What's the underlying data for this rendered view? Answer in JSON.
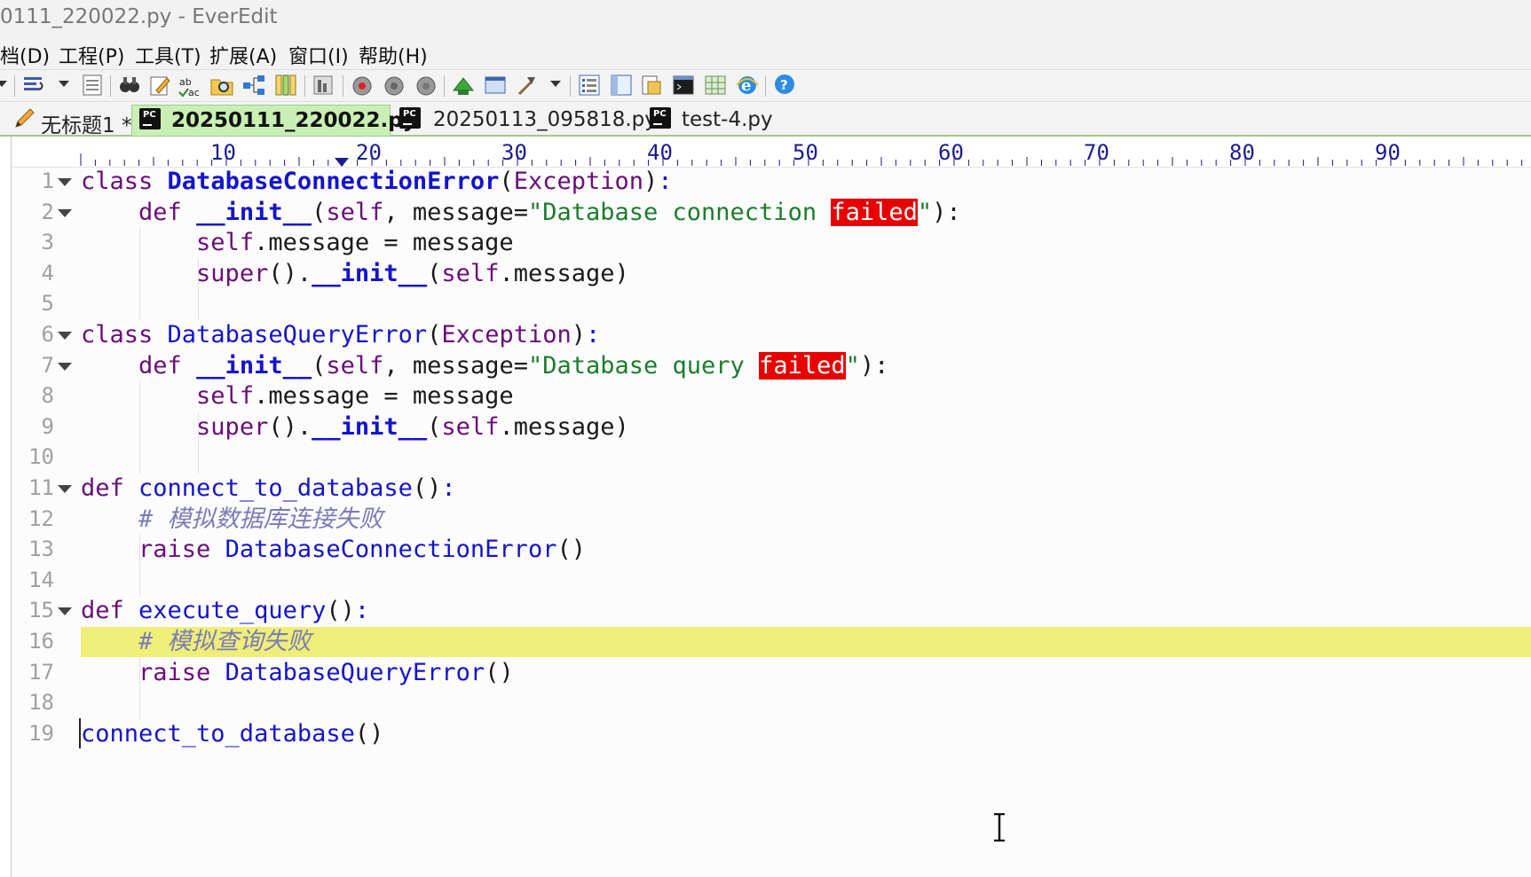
{
  "window": {
    "title": "0111_220022.py - EverEdit"
  },
  "menu": [
    "档(D)",
    "工程(P)",
    "工具(T)",
    "扩展(A)",
    "窗口(I)",
    "帮助(H)"
  ],
  "toolbar": {
    "buttons": [
      "word-wrap-icon",
      "document-icon",
      "find-icon",
      "edit-icon",
      "spell-check-icon",
      "find-in-files-icon",
      "split-icon",
      "columns-icon",
      "macro-icon",
      "record-macro-icon",
      "play-macro-icon",
      "stop-macro-icon",
      "plugin-icon",
      "window-icon",
      "tool-icon",
      "list-icon",
      "panel-icon",
      "clip-icon",
      "terminal-icon",
      "grid-icon",
      "browser-icon",
      "help-icon"
    ]
  },
  "tabs": [
    {
      "label": "无标题1 *",
      "active": false
    },
    {
      "label": "20250111_220022.py",
      "active": true
    },
    {
      "label": "20250113_095818.py",
      "active": false
    },
    {
      "label": "test-4.py",
      "active": false
    }
  ],
  "ruler": {
    "marks": [
      "10",
      "20",
      "30",
      "40",
      "50",
      "60",
      "70",
      "80",
      "90"
    ]
  },
  "editor": {
    "line_numbers": [
      "1",
      "2",
      "3",
      "4",
      "5",
      "6",
      "7",
      "8",
      "9",
      "10",
      "11",
      "12",
      "13",
      "14",
      "15",
      "16",
      "17",
      "18",
      "19"
    ],
    "current_line": "16",
    "lines": [
      [
        [
          "kw",
          "class "
        ],
        [
          "kb",
          "DatabaseConnectionError"
        ],
        [
          "",
          "("
        ],
        [
          "kw",
          "Exception"
        ],
        [
          "",
          ")"
        ],
        [
          "fn",
          ":"
        ]
      ],
      [
        [
          "",
          "    "
        ],
        [
          "kw",
          "def "
        ],
        [
          "kb",
          "__init__"
        ],
        [
          "",
          "("
        ],
        [
          "sf",
          "self"
        ],
        [
          "",
          ", message="
        ],
        [
          "str",
          "\"Database connection "
        ],
        [
          "red",
          "failed"
        ],
        [
          "str",
          "\""
        ],
        [
          "",
          "):"
        ]
      ],
      [
        [
          "",
          "        "
        ],
        [
          "sf",
          "self"
        ],
        [
          "",
          ".message = message"
        ]
      ],
      [
        [
          "",
          "        "
        ],
        [
          "sf",
          "super"
        ],
        [
          "",
          "()."
        ],
        [
          "kb",
          "__init__"
        ],
        [
          "",
          "("
        ],
        [
          "sf",
          "self"
        ],
        [
          "",
          ".message)"
        ]
      ],
      [
        [
          "",
          ""
        ]
      ],
      [
        [
          "kw",
          "class "
        ],
        [
          "fn",
          "DatabaseQueryError"
        ],
        [
          "",
          "("
        ],
        [
          "kw",
          "Exception"
        ],
        [
          "",
          ")"
        ],
        [
          "fn",
          ":"
        ]
      ],
      [
        [
          "",
          "    "
        ],
        [
          "kw",
          "def "
        ],
        [
          "kb",
          "__init__"
        ],
        [
          "",
          "("
        ],
        [
          "sf",
          "self"
        ],
        [
          "",
          ", message="
        ],
        [
          "str",
          "\"Database query "
        ],
        [
          "red",
          "failed"
        ],
        [
          "str",
          "\""
        ],
        [
          "",
          "):"
        ]
      ],
      [
        [
          "",
          "        "
        ],
        [
          "sf",
          "self"
        ],
        [
          "",
          ".message = message"
        ]
      ],
      [
        [
          "",
          "        "
        ],
        [
          "sf",
          "super"
        ],
        [
          "",
          "()."
        ],
        [
          "kb",
          "__init__"
        ],
        [
          "",
          "("
        ],
        [
          "sf",
          "self"
        ],
        [
          "",
          ".message)"
        ]
      ],
      [
        [
          "",
          ""
        ]
      ],
      [
        [
          "kw",
          "def "
        ],
        [
          "fn",
          "connect_to_database"
        ],
        [
          "",
          "()"
        ],
        [
          "fn",
          ":"
        ]
      ],
      [
        [
          "",
          "    "
        ],
        [
          "cm",
          "# 模拟数据库连接失败"
        ]
      ],
      [
        [
          "",
          "    "
        ],
        [
          "kw",
          "raise "
        ],
        [
          "fn",
          "DatabaseConnectionError"
        ],
        [
          "",
          "()"
        ]
      ],
      [
        [
          "",
          ""
        ]
      ],
      [
        [
          "kw",
          "def "
        ],
        [
          "fn",
          "execute_query"
        ],
        [
          "",
          "()"
        ],
        [
          "fn",
          ":"
        ]
      ],
      [
        [
          "",
          "    "
        ],
        [
          "cm",
          "# 模拟查询失败"
        ]
      ],
      [
        [
          "",
          "    "
        ],
        [
          "kw",
          "raise "
        ],
        [
          "fn",
          "DatabaseQueryError"
        ],
        [
          "",
          "()"
        ]
      ],
      [
        [
          "",
          ""
        ]
      ],
      [
        [
          "fn",
          "connect_to_database"
        ],
        [
          "",
          "()"
        ]
      ]
    ]
  }
}
